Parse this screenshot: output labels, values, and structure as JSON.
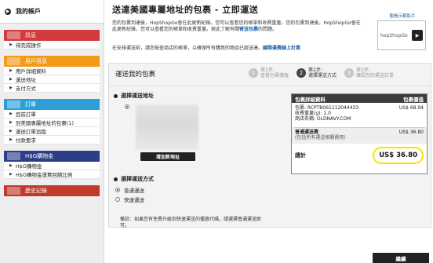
{
  "sidebar": {
    "account_label": "我的帳戶",
    "sections": [
      {
        "title": "訊息",
        "color": "#d13b3b",
        "items": [
          "待完成操作"
        ]
      },
      {
        "title": "用戶訊息",
        "color": "#f39a1b",
        "items": [
          "用戶詳細資料",
          "運送地址",
          "支付方式"
        ]
      },
      {
        "title": "訂單",
        "color": "#2c9fd8",
        "items": [
          "目前訂單",
          "到美國專屬地址的包裹(1)",
          "運送訂單追蹤",
          "付款要求"
        ]
      },
      {
        "title": "H$G購物金",
        "color": "#2c3e8a",
        "items": [
          "H$G購物金",
          "H$G購物金運費回饋比例"
        ]
      },
      {
        "title": "歷史記錄",
        "color": "#c0392b",
        "items": []
      }
    ]
  },
  "page": {
    "title": "送達美國專屬地址的包裹 - 立即運送",
    "intro": "您的包裹到達後，HopShopGo會在此更新紀錄。您可以查看您的帳單和收費重量。您的包裹到達後，HopShopGo會在此更新紀錄，您可以查看您的帳單和收費重量。按此了解有關",
    "intro_link": "寄送包裹",
    "intro_tail": "的問題。",
    "notice": "在安排運送前，請您檢查商店的帳單，以確保所有購買的物品已經送達。",
    "notice_link": "國際運費線上計算"
  },
  "video": {
    "label": "觀看示範影片",
    "brand": "hopShopGo"
  },
  "panel": {
    "title": "運送我的包裹",
    "steps": [
      {
        "num": "1",
        "label1": "第1步:",
        "label2": "查看包裹價值",
        "active": false
      },
      {
        "num": "2",
        "label1": "第2步:",
        "label2": "選擇運送方式",
        "active": true
      },
      {
        "num": "3",
        "label1": "第3步:",
        "label2": "確認您的運送訂單",
        "active": false
      }
    ],
    "address_heading": "選擇運送地址",
    "add_address_button": "增加新地址",
    "shipping_heading": "選擇運送方式",
    "shipping_options": [
      "普通運送",
      "快速運送"
    ],
    "remark": "備註：如果您有免費升級到快速運送的優惠代碼，請選擇普通運送即可。"
  },
  "detail": {
    "header_left": "包裹詳細資料",
    "header_right": "包裹價值",
    "package_id": "包裹: RCPTB061112044433",
    "weight": "收費重量(g): 1.0",
    "store": "商店名稱: OLDNAVY.COM",
    "package_value": "US$ 68.94",
    "ship_label": "普通運送費",
    "ship_sub": "(包括所有運送相關費用)",
    "ship_value": "US$ 36.80",
    "total_label": "總計",
    "total_value": "US$ 36.80",
    "highlight_color": "#f6e500"
  },
  "next_button": "繼續"
}
